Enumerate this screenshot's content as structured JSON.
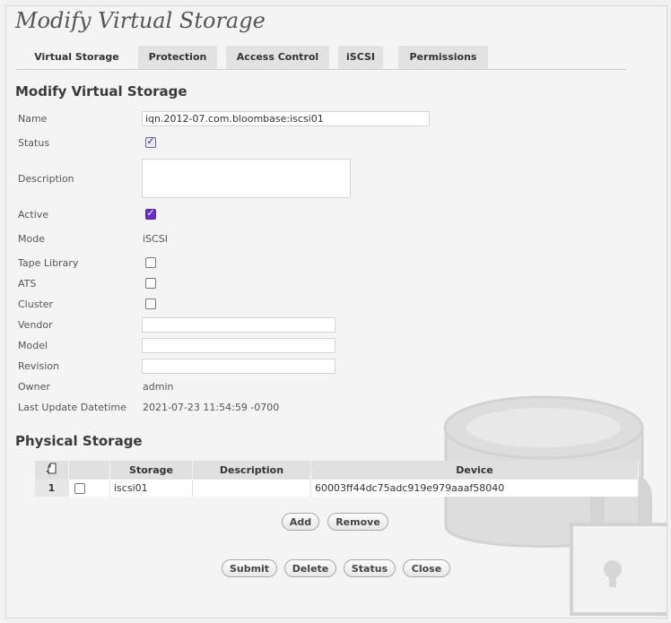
{
  "header": {
    "title": "Modify Virtual Storage"
  },
  "tabs": [
    {
      "label": "Virtual Storage"
    },
    {
      "label": "Protection"
    },
    {
      "label": "Access Control"
    },
    {
      "label": "iSCSI"
    },
    {
      "label": "Permissions"
    }
  ],
  "form": {
    "section_title": "Modify Virtual Storage",
    "name_label": "Name",
    "name_value": "iqn.2012-07.com.bloombase:iscsi01",
    "status_label": "Status",
    "status_checked": true,
    "description_label": "Description",
    "description_value": "",
    "active_label": "Active",
    "active_checked": true,
    "mode_label": "Mode",
    "mode_value": "iSCSI",
    "tape_library_label": "Tape Library",
    "ats_label": "ATS",
    "cluster_label": "Cluster",
    "vendor_label": "Vendor",
    "vendor_value": "",
    "model_label": "Model",
    "model_value": "",
    "revision_label": "Revision",
    "revision_value": "",
    "owner_label": "Owner",
    "owner_value": "admin",
    "last_update_label": "Last Update Datetime",
    "last_update_value": "2021-07-23 11:54:59 -0700"
  },
  "physical": {
    "section_title": "Physical Storage",
    "columns": {
      "storage": "Storage",
      "description": "Description",
      "device": "Device"
    },
    "rows": [
      {
        "num": "1",
        "storage": "iscsi01",
        "description": "",
        "device": "60003ff44dc75adc919e979aaaf58040"
      }
    ],
    "add_label": "Add",
    "remove_label": "Remove"
  },
  "actions": {
    "submit_label": "Submit",
    "delete_label": "Delete",
    "status_label": "Status",
    "close_label": "Close"
  },
  "colors": {
    "accent": "#6a2fc8",
    "tab_bg": "#e2e2e2",
    "header_bg": "#e0e0e0"
  }
}
